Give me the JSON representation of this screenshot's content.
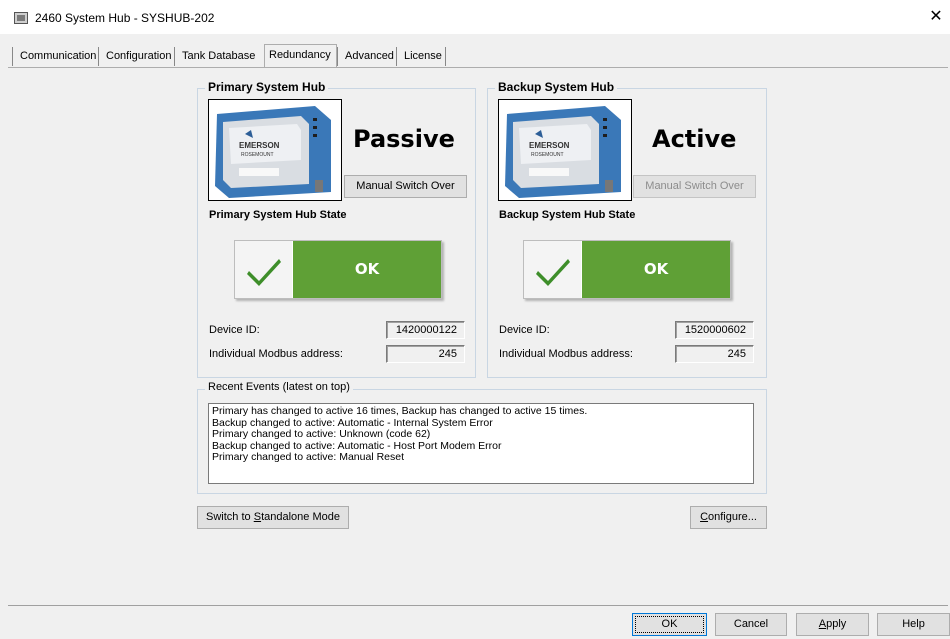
{
  "window": {
    "title": "2460 System Hub  - SYSHUB-202",
    "close_icon": "close-icon"
  },
  "tabs": [
    {
      "label": "Communication"
    },
    {
      "label": "Configuration"
    },
    {
      "label": "Tank Database"
    },
    {
      "label": "Redundancy",
      "active": true
    },
    {
      "label": "Advanced"
    },
    {
      "label": "License"
    }
  ],
  "primary": {
    "group_title": "Primary System Hub",
    "mode": "Passive",
    "switch_button": "Manual Switch Over",
    "switch_enabled": true,
    "state_label": "Primary System Hub State",
    "state": "OK",
    "device_id_label": "Device ID:",
    "device_id": "1420000122",
    "modbus_label": "Individual Modbus address:",
    "modbus_address": "245",
    "image_brand": "EMERSON",
    "image_sub": "ROSEMOUNT"
  },
  "backup": {
    "group_title": "Backup System Hub",
    "mode": "Active",
    "switch_button": "Manual Switch Over",
    "switch_enabled": false,
    "state_label": "Backup System Hub State",
    "state": "OK",
    "device_id_label": "Device ID:",
    "device_id": "1520000602",
    "modbus_label": "Individual Modbus address:",
    "modbus_address": "245",
    "image_brand": "EMERSON",
    "image_sub": "ROSEMOUNT"
  },
  "events": {
    "title": "Recent Events (latest on top)",
    "lines": [
      "Primary has changed to active 16 times, Backup has changed to active 15 times.",
      "Backup changed to active: Automatic - Internal System Error",
      "Primary changed to active: Unknown (code 62)",
      "Backup changed to active: Automatic - Host Port Modem Error",
      "Primary changed to active: Manual Reset"
    ]
  },
  "actions": {
    "standalone_pre": "Switch to ",
    "standalone_ul": "S",
    "standalone_post": "tandalone Mode",
    "configure_ul": "C",
    "configure_post": "onfigure..."
  },
  "dialog": {
    "ok": "OK",
    "cancel": "Cancel",
    "apply_ul": "A",
    "apply_post": "pply",
    "help": "Help"
  },
  "colors": {
    "ok_green": "#5fa036",
    "check_green": "#3e8e2a",
    "device_blue": "#3a78b8"
  }
}
